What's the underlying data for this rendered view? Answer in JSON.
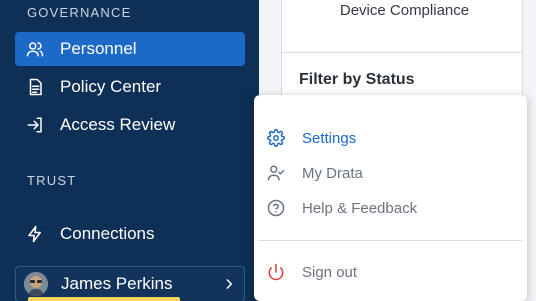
{
  "colors": {
    "sidebar_bg": "#0e2f56",
    "active_item": "#1c69c7",
    "signout_red": "#d93c3c",
    "menu_text": "#6b7480"
  },
  "sidebar": {
    "governance_label": "GOVERNANCE",
    "trust_label": "TRUST",
    "items": [
      {
        "label": "Personnel",
        "icon": "users-icon",
        "active": true
      },
      {
        "label": "Policy Center",
        "icon": "document-icon",
        "active": false
      },
      {
        "label": "Access Review",
        "icon": "login-arrow-icon",
        "active": false
      },
      {
        "label": "Connections",
        "icon": "bolt-icon",
        "active": false
      }
    ],
    "user": {
      "name": "James Perkins",
      "icon": "chevron-right-icon"
    }
  },
  "content": {
    "device_compliance": "Device Compliance",
    "filter_title": "Filter by Status"
  },
  "menu": {
    "items": [
      {
        "label": "Settings",
        "icon": "gear-icon",
        "active": true
      },
      {
        "label": "My Drata",
        "icon": "user-check-icon",
        "active": false
      },
      {
        "label": "Help & Feedback",
        "icon": "help-circle-icon",
        "active": false
      }
    ],
    "signout": {
      "label": "Sign out",
      "icon": "power-icon"
    }
  }
}
